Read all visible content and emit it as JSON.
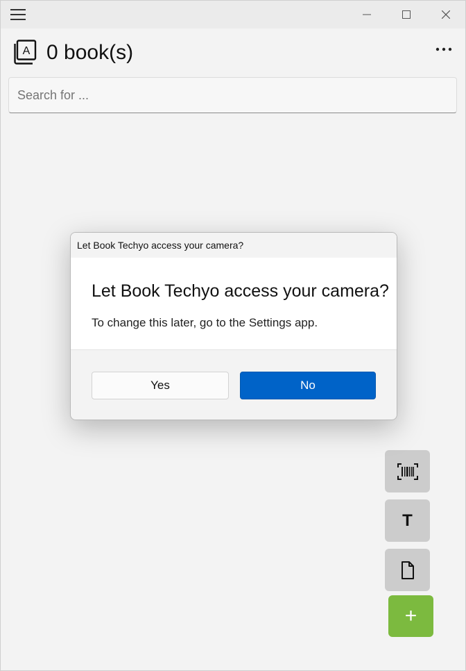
{
  "header": {
    "book_count": "0 book(s)"
  },
  "search": {
    "placeholder": "Search for ..."
  },
  "fab": {
    "text_label": "T",
    "add_label": "+"
  },
  "dialog": {
    "caption": "Let Book Techyo access your camera?",
    "title": "Let Book Techyo access your camera?",
    "message": "To change this later, go to the Settings app.",
    "yes_label": "Yes",
    "no_label": "No"
  },
  "colors": {
    "accent": "#0063c8",
    "add_button": "#7cba3f",
    "fab_background": "#cccccc"
  },
  "icons": [
    "hamburger-icon",
    "minimize-icon",
    "maximize-icon",
    "close-icon",
    "book-icon",
    "more-icon",
    "barcode-icon",
    "text-icon",
    "document-icon",
    "plus-icon"
  ]
}
